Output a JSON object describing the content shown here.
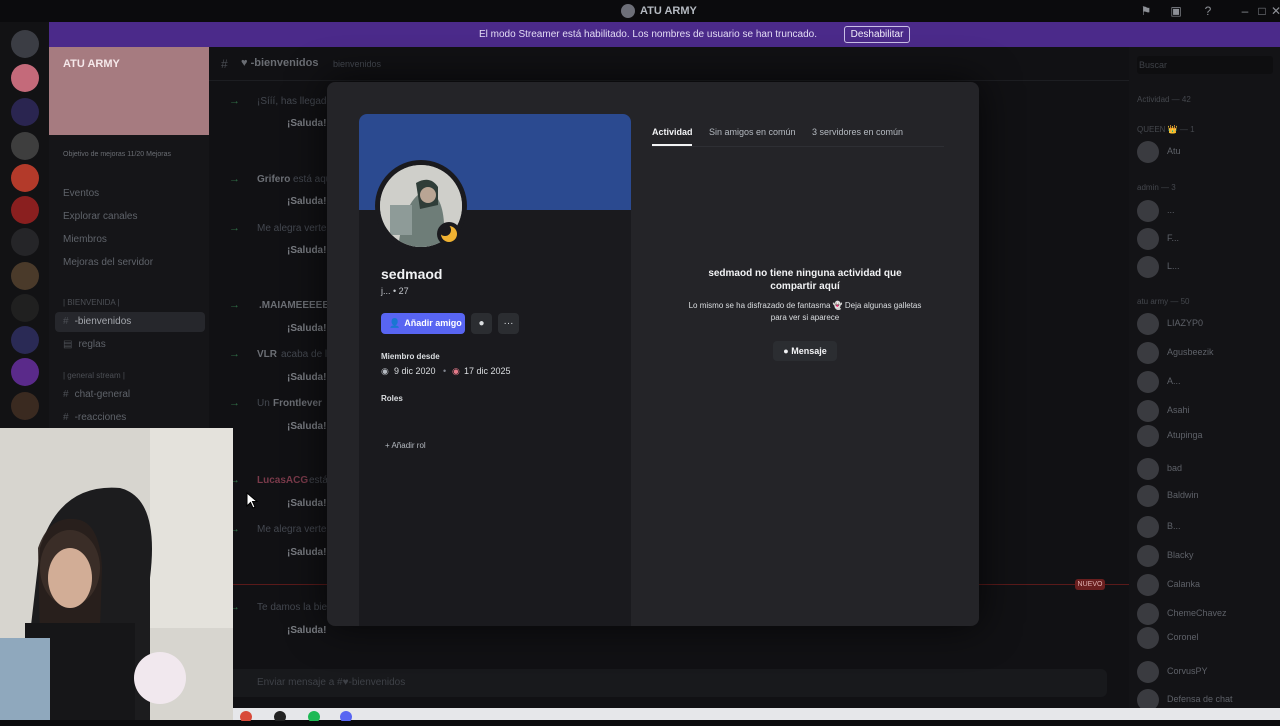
{
  "window": {
    "title": "ATU ARMY"
  },
  "banner": {
    "text": "El modo Streamer está habilitado. Los nombres de usuario se han truncado.",
    "button": "Deshabilitar"
  },
  "server": {
    "name": "ATU ARMY",
    "boost": "Objetivo de mejoras 11/20 Mejoras",
    "links": [
      "Eventos",
      "Explorar canales",
      "Miembros",
      "Mejoras del servidor"
    ],
    "categories": [
      "| BIENVENIDA |",
      "| general stream |"
    ],
    "channels": [
      "-bienvenidos",
      "reglas",
      "chat-general",
      "-reacciones"
    ]
  },
  "chat": {
    "channel_name": "-bienvenidos",
    "topic": "bienvenidos",
    "messages": [
      {
        "lead": "¡Sííí, has llegado",
        "wave": "¡Saluda!"
      },
      {
        "name": "Grifero",
        "lead": "está aquí",
        "wave": "¡Saluda!"
      },
      {
        "lead": "Me alegra verte",
        "wave": "¡Saluda!"
      },
      {
        "name": ".MAIAMEEEEE",
        "wave": "¡Saluda!"
      },
      {
        "name": "VLR",
        "lead": "acaba de llegar",
        "wave": "¡Saluda!"
      },
      {
        "name": "Frontlever",
        "lead": "Un",
        "wave": "¡Saluda!"
      },
      {
        "name": "LucasACG",
        "lead": "está aquí",
        "wave": "¡Saluda!"
      },
      {
        "lead": "Me alegra verte",
        "wave": "¡Saluda!"
      },
      {
        "lead": "Te damos la bienvenida",
        "wave": "¡Saluda!"
      }
    ],
    "new_badge": "NUEVO",
    "input_placeholder": "Enviar mensaje a #♥-bienvenidos"
  },
  "members": {
    "search_placeholder": "Buscar",
    "activity": "Actividad — 42",
    "groups": [
      {
        "title": "QUEEN 👑 — 1",
        "names": [
          "Atu"
        ]
      },
      {
        "title": "admin — 3",
        "names": [
          "...",
          "F...",
          "L..."
        ]
      },
      {
        "title": "atu army — 50",
        "names": [
          "LIAZYP0",
          "Agusbeezik",
          "A...",
          "Asahi",
          "Atupinga",
          "bad",
          "Baldwin",
          "B...",
          "Blacky",
          "Calanka",
          "ChemeChavez",
          "Coronel",
          "CorvusPY",
          "Defensa de chat"
        ]
      }
    ]
  },
  "profile": {
    "username": "sedmaod",
    "subline": "j... • 27",
    "add_friend": "Añadir amigo",
    "member_since_label": "Miembro desde",
    "discord_date": "9 dic 2020",
    "server_date": "17 dic 2025",
    "roles_label": "Roles",
    "add_role": "Añadir rol",
    "tabs": [
      "Actividad",
      "Sin amigos en común",
      "3 servidores en común"
    ],
    "empty_title": "sedmaod no tiene ninguna actividad que compartir aquí",
    "empty_sub": "Lo mismo se ha disfrazado de fantasma 👻 Deja algunas galletas para ver si aparece",
    "message_button": "Mensaje",
    "status_color": "#f0b232",
    "banner_color": "#2b4a90",
    "accent": "#5865f2"
  }
}
